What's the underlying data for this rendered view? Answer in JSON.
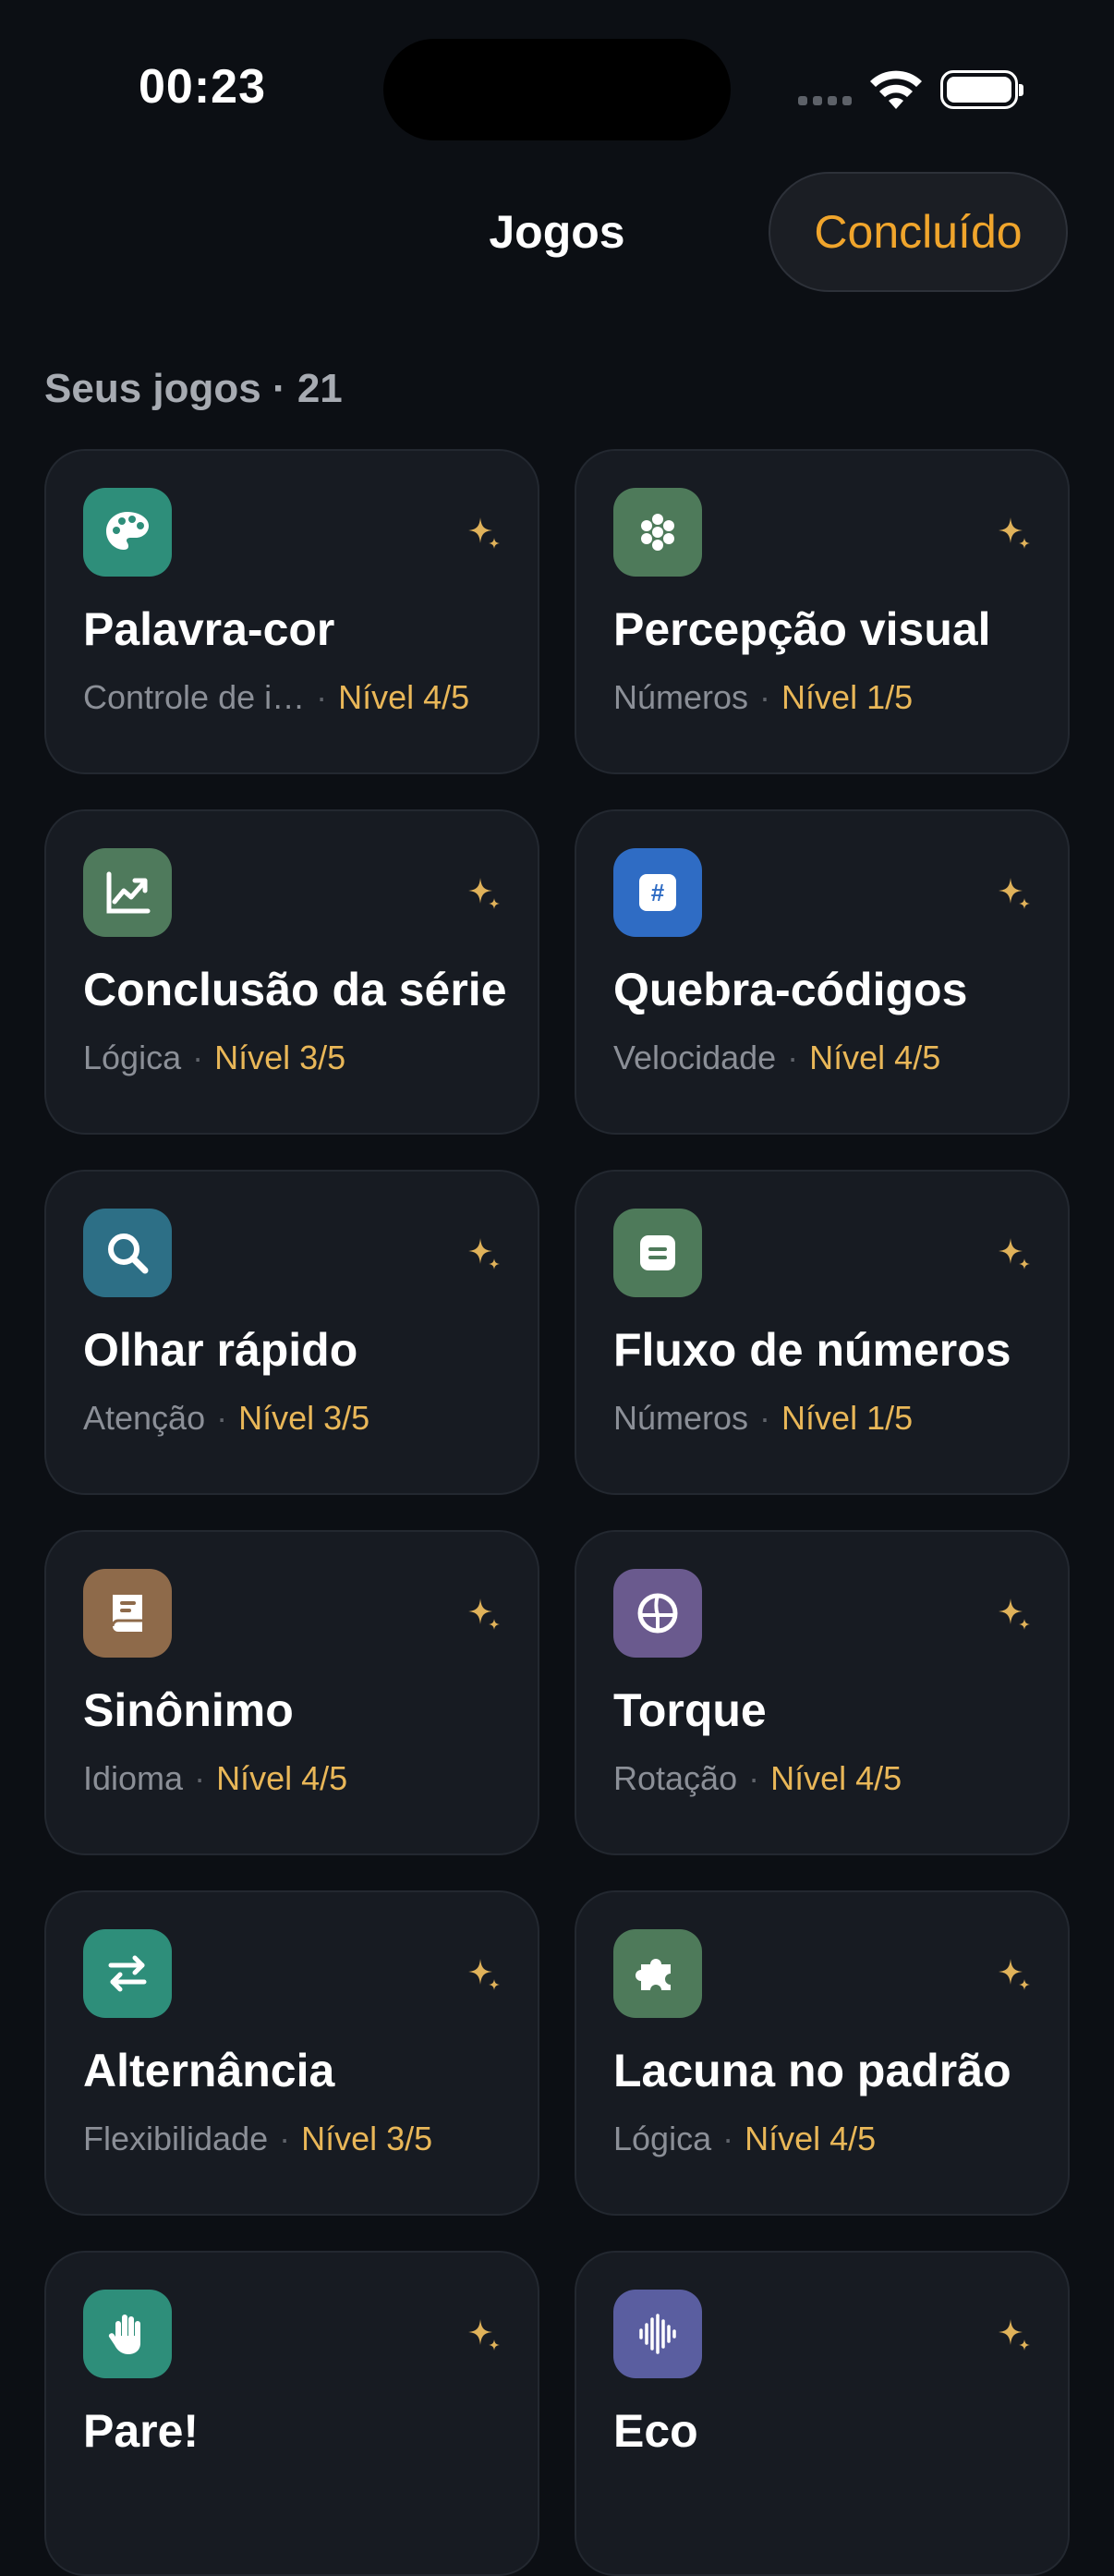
{
  "status": {
    "time": "00:23"
  },
  "header": {
    "title": "Jogos",
    "done_label": "Concluído"
  },
  "section": {
    "label": "Seus jogos · 21"
  },
  "colors": {
    "accent": "#f0a52c",
    "level": "#e9b758",
    "background": "#0c0f14",
    "card": "#171b22"
  },
  "games": [
    {
      "title": "Palavra-cor",
      "category": "Controle de i…",
      "level": "Nível 4/5",
      "icon": "palette-icon",
      "icon_color": "#2e8e7a"
    },
    {
      "title": "Percepção visual",
      "category": "Números",
      "level": "Nível 1/5",
      "icon": "dots-cluster-icon",
      "icon_color": "#4e7a5a"
    },
    {
      "title": "Conclusão da série",
      "category": "Lógica",
      "level": "Nível 3/5",
      "icon": "chart-trend-icon",
      "icon_color": "#4f7a5c"
    },
    {
      "title": "Quebra-códigos",
      "category": "Velocidade",
      "level": "Nível 4/5",
      "icon": "hashtag-icon",
      "icon_color": "#2f6cc4"
    },
    {
      "title": "Olhar rápido",
      "category": "Atenção",
      "level": "Nível 3/5",
      "icon": "magnifier-icon",
      "icon_color": "#2d6f86"
    },
    {
      "title": "Fluxo de números",
      "category": "Números",
      "level": "Nível 1/5",
      "icon": "document-icon",
      "icon_color": "#4e7a5a"
    },
    {
      "title": "Sinônimo",
      "category": "Idioma",
      "level": "Nível 4/5",
      "icon": "book-icon",
      "icon_color": "#8e6a4a"
    },
    {
      "title": "Torque",
      "category": "Rotação",
      "level": "Nível 4/5",
      "icon": "rotation-icon",
      "icon_color": "#6a5a8e"
    },
    {
      "title": "Alternância",
      "category": "Flexibilidade",
      "level": "Nível 3/5",
      "icon": "arrows-swap-icon",
      "icon_color": "#2e8e7a"
    },
    {
      "title": "Lacuna no padrão",
      "category": "Lógica",
      "level": "Nível 4/5",
      "icon": "puzzle-icon",
      "icon_color": "#4e7a5a"
    },
    {
      "title": "Pare!",
      "category": "",
      "level": "",
      "icon": "hand-icon",
      "icon_color": "#2e8e7a"
    },
    {
      "title": "Eco",
      "category": "",
      "level": "",
      "icon": "waveform-icon",
      "icon_color": "#5a5ea0"
    }
  ]
}
